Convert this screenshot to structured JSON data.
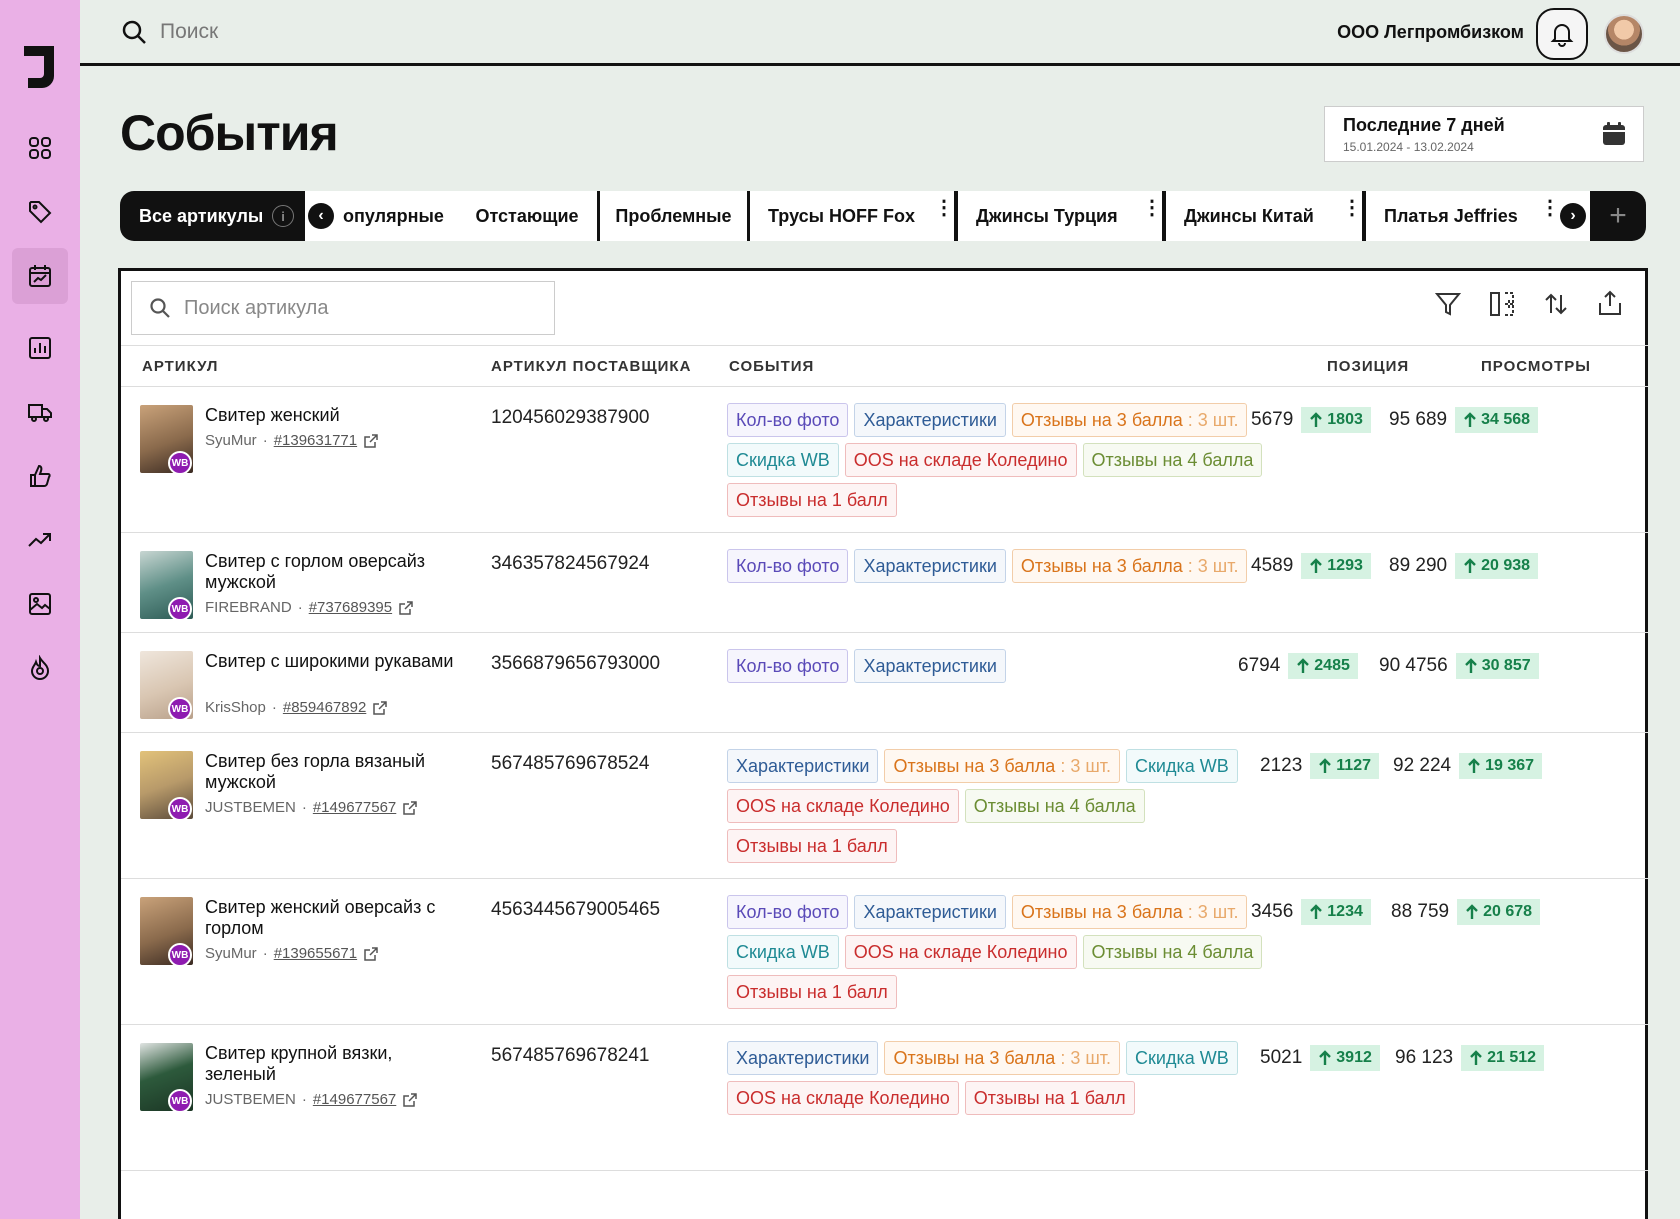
{
  "search": {
    "placeholder": "Поиск"
  },
  "header": {
    "company": "ООО Легпромбизком"
  },
  "page": {
    "title": "События"
  },
  "period": {
    "label": "Последние 7 дней",
    "range": "15.01.2024 - 13.02.2024"
  },
  "tabs": {
    "all": "Все артикулы",
    "info": "i",
    "items": [
      {
        "label": "опулярные"
      },
      {
        "label": "Отстающие"
      },
      {
        "label": "Проблемные"
      },
      {
        "label": "Трусы HOFF Fox"
      },
      {
        "label": "Джинсы Турция"
      },
      {
        "label": "Джинсы Китай"
      },
      {
        "label": "Платья Jeffries"
      }
    ],
    "prev": "‹",
    "next": "›",
    "add": "+"
  },
  "table": {
    "search_placeholder": "Поиск артикула",
    "columns": {
      "article": "АРТИКУЛ",
      "supplier_article": "АРТИКУЛ ПОСТАВЩИКА",
      "events": "СОБЫТИЯ",
      "position": "ПОЗИЦИЯ",
      "views": "ПРОСМОТРЫ"
    },
    "badge": "WB",
    "rows": [
      {
        "name": "Свитер женский",
        "seller": "SyuMur",
        "id": "#139631771",
        "sku": "120456029387900",
        "events": [
          [
            "Кол-во фото",
            "purple"
          ],
          [
            "Характеристики",
            "blue"
          ],
          [
            "Отзывы на 3 балла",
            "orange",
            ": 3 шт."
          ],
          [
            "Скидка WB",
            "teal"
          ],
          [
            "OOS на складе Коледино",
            "red"
          ],
          [
            "Отзывы на 4 балла",
            "olive"
          ],
          [
            "Отзывы на 1 балл",
            "red"
          ]
        ],
        "position": "5679",
        "position_delta": "1803",
        "views": "95 689",
        "views_delta": "34 568"
      },
      {
        "name": "Свитер с горлом оверсайз мужской",
        "seller": "FIREBRAND",
        "id": "#737689395",
        "sku": "346357824567924",
        "events": [
          [
            "Кол-во фото",
            "purple"
          ],
          [
            "Характеристики",
            "blue"
          ],
          [
            "Отзывы на 3 балла",
            "orange",
            ": 3 шт."
          ]
        ],
        "position": "4589",
        "position_delta": "1293",
        "views": "89 290",
        "views_delta": "20 938"
      },
      {
        "name": "Свитер с широкими рукавами",
        "seller": "KrisShop",
        "id": "#859467892",
        "sku": "3566879656793000",
        "events": [
          [
            "Кол-во фото",
            "purple"
          ],
          [
            "Характеристики",
            "blue"
          ]
        ],
        "position": "6794",
        "position_delta": "2485",
        "views": "90 4756",
        "views_delta": "30 857"
      },
      {
        "name": "Свитер без горла вязаный мужской",
        "seller": "JUSTBEMEN",
        "id": "#149677567",
        "sku": "567485769678524",
        "events": [
          [
            "Характеристики",
            "blue"
          ],
          [
            "Отзывы на 3 балла",
            "orange",
            ": 3 шт."
          ],
          [
            "Скидка WB",
            "teal"
          ],
          [
            "OOS на складе Коледино",
            "red"
          ],
          [
            "Отзывы на 4 балла",
            "olive"
          ],
          [
            "Отзывы на 1 балл",
            "red"
          ]
        ],
        "position": "2123",
        "position_delta": "1127",
        "views": "92 224",
        "views_delta": "19 367"
      },
      {
        "name": "Свитер женский оверсайз с горлом",
        "seller": "SyuMur",
        "id": "#139655671",
        "sku": "4563445679005465",
        "events": [
          [
            "Кол-во фото",
            "purple"
          ],
          [
            "Характеристики",
            "blue"
          ],
          [
            "Отзывы на 3 балла",
            "orange",
            ": 3 шт."
          ],
          [
            "Скидка WB",
            "teal"
          ],
          [
            "OOS на складе Коледино",
            "red"
          ],
          [
            "Отзывы на 4 балла",
            "olive"
          ],
          [
            "Отзывы на 1 балл",
            "red"
          ]
        ],
        "position": "3456",
        "position_delta": "1234",
        "views": "88 759",
        "views_delta": "20 678"
      },
      {
        "name": "Свитер крупной вязки, зеленый",
        "seller": "JUSTBEMEN",
        "id": "#149677567",
        "sku": "567485769678241",
        "events": [
          [
            "Характеристики",
            "blue"
          ],
          [
            "Отзывы на 3 балла",
            "orange",
            ": 3 шт."
          ],
          [
            "Скидка WB",
            "teal"
          ],
          [
            "OOS на складе Коледино",
            "red"
          ],
          [
            "Отзывы на 1 балл",
            "red"
          ]
        ],
        "position": "5021",
        "position_delta": "3912",
        "views": "96 123",
        "views_delta": "21 512"
      }
    ]
  },
  "colors": {
    "sidebar": "#eab0e6",
    "background": "#e8eee9",
    "accent_dark": "#111111",
    "delta_bg": "#d6f2e2",
    "delta_fg": "#16804a",
    "wb_badge": "#8e1bb0"
  },
  "icons": [
    "logo",
    "grid-icon",
    "tag-icon",
    "calendar-chart-icon",
    "bar-chart-icon",
    "truck-icon",
    "thumb-up-icon",
    "trend-up-icon",
    "image-icon",
    "fire-icon",
    "search-icon",
    "bell-icon",
    "calendar-icon",
    "filter-icon",
    "columns-icon",
    "sort-icon",
    "export-icon",
    "external-link-icon",
    "arrow-up-icon"
  ]
}
